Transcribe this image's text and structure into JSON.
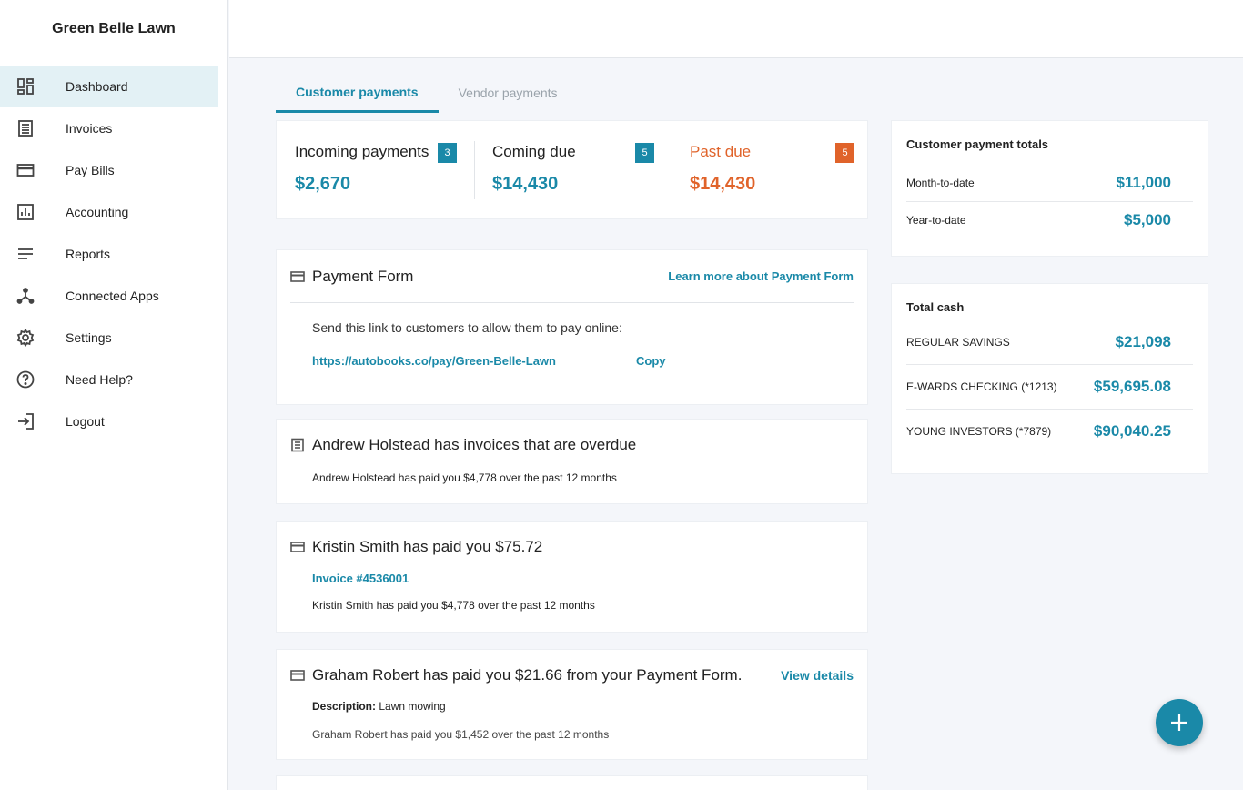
{
  "brand": "Green Belle Lawn",
  "nav": [
    {
      "label": "Dashboard",
      "icon": "dashboard-icon",
      "active": true
    },
    {
      "label": "Invoices",
      "icon": "invoice-icon"
    },
    {
      "label": "Pay Bills",
      "icon": "credit-card-icon"
    },
    {
      "label": "Accounting",
      "icon": "bar-chart-icon"
    },
    {
      "label": "Reports",
      "icon": "lines-icon"
    },
    {
      "label": "Connected Apps",
      "icon": "network-icon"
    },
    {
      "label": "Settings",
      "icon": "gear-icon"
    },
    {
      "label": "Need Help?",
      "icon": "help-icon"
    },
    {
      "label": "Logout",
      "icon": "logout-icon"
    }
  ],
  "tabs": {
    "customer": "Customer payments",
    "vendor": "Vendor payments"
  },
  "summary": {
    "incoming": {
      "title": "Incoming payments",
      "badge": "3",
      "amount": "$2,670"
    },
    "coming_due": {
      "title": "Coming due",
      "badge": "5",
      "amount": "$14,430"
    },
    "past_due": {
      "title": "Past due",
      "badge": "5",
      "amount": "$14,430"
    }
  },
  "totals": {
    "title": "Customer payment totals",
    "rows": [
      {
        "label": "Month-to-date",
        "value": "$11,000"
      },
      {
        "label": "Year-to-date",
        "value": "$5,000"
      }
    ]
  },
  "cash": {
    "title": "Total cash",
    "rows": [
      {
        "label": "REGULAR SAVINGS",
        "value": "$21,098"
      },
      {
        "label": "E-WARDS CHECKING (*1213)",
        "value": "$59,695.08"
      },
      {
        "label": "YOUNG INVESTORS (*7879)",
        "value": "$90,040.25"
      }
    ]
  },
  "payment_form": {
    "title": "Payment Form",
    "learn_more": "Learn more about Payment Form",
    "instruction": "Send this link to customers to allow them to pay online:",
    "url": "https://autobooks.co/pay/Green-Belle-Lawn",
    "copy": "Copy"
  },
  "andrew": {
    "title": "Andrew Holstead has invoices that are overdue",
    "detail": "Andrew Holstead has paid you $4,778 over the past 12 months"
  },
  "kristin": {
    "title": "Kristin Smith has paid you $75.72",
    "invoice_link": "Invoice #4536001",
    "detail": "Kristin Smith has paid you $4,778 over the past 12 months"
  },
  "graham": {
    "title": "Graham Robert has paid you $21.66 from your Payment Form.",
    "view_details": "View details",
    "description_label": "Description:",
    "description": "Lawn mowing",
    "detail": "Graham Robert has paid you $1,452 over the past 12 months"
  },
  "colors": {
    "accent": "#1a89a8",
    "pastdue": "#e0632a"
  }
}
